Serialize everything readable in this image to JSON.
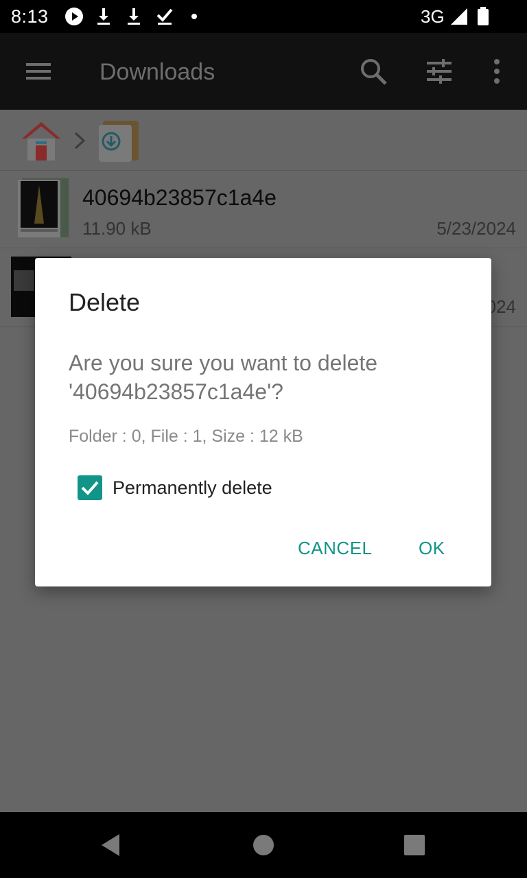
{
  "status_bar": {
    "time": "8:13",
    "network": "3G",
    "icons": [
      "play-icon",
      "download-icon",
      "download-icon",
      "done-icon",
      "dot-icon",
      "signal-icon",
      "battery-icon"
    ]
  },
  "toolbar": {
    "title": "Downloads",
    "icons": [
      "menu-icon",
      "search-icon",
      "filter-icon",
      "more-vert-icon"
    ]
  },
  "breadcrumb": {
    "icons": [
      "home-icon",
      "chevron-right-icon",
      "downloads-folder-icon"
    ]
  },
  "files": [
    {
      "name": "40694b23857c1a4e",
      "size": "11.90 kB",
      "date": "5/23/2024"
    },
    {
      "name": "",
      "size": "",
      "date": "024"
    }
  ],
  "dialog": {
    "title": "Delete",
    "message": "Are you sure you want to delete '40694b23857c1a4e'?",
    "info": "Folder : 0, File : 1, Size : 12 kB",
    "checkbox_label": "Permanently delete",
    "checkbox_checked": true,
    "cancel_label": "CANCEL",
    "ok_label": "OK",
    "accent_color": "#129488"
  },
  "nav_bar": {
    "icons": [
      "back-icon",
      "home-circle-icon",
      "recents-icon"
    ]
  }
}
